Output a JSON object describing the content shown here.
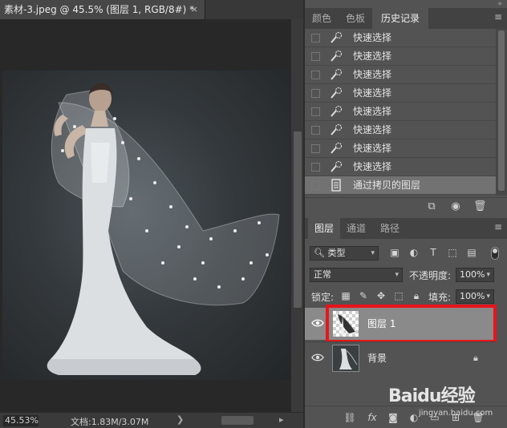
{
  "document": {
    "tab_title": "素材-3.jpeg @ 45.5% (图层 1, RGB/8#) *",
    "tab_close": "×"
  },
  "status": {
    "zoom": "45.53%",
    "doc_info": "文档:1.83M/3.07M",
    "arrow": "❯"
  },
  "history_panel": {
    "tabs": [
      "颜色",
      "色板",
      "历史记录"
    ],
    "active_tab": "历史记录",
    "items": [
      {
        "label": "快速选择"
      },
      {
        "label": "快速选择"
      },
      {
        "label": "快速选择"
      },
      {
        "label": "快速选择"
      },
      {
        "label": "快速选择"
      },
      {
        "label": "快速选择"
      },
      {
        "label": "快速选择"
      },
      {
        "label": "快速选择"
      },
      {
        "label": "通过拷贝的图层",
        "selected": true
      }
    ]
  },
  "layers_panel": {
    "tabs": [
      "图层",
      "通道",
      "路径"
    ],
    "active_tab": "图层",
    "filter_kind": "类型",
    "blend_mode": "正常",
    "opacity_label": "不透明度:",
    "opacity_value": "100%",
    "lock_label": "锁定:",
    "fill_label": "填充:",
    "fill_value": "100%",
    "layers": [
      {
        "name": "图层 1",
        "selected": true,
        "visible": true,
        "locked": false
      },
      {
        "name": "背景",
        "selected": false,
        "visible": true,
        "locked": true
      }
    ]
  },
  "watermark": {
    "brand": "Baidu经验",
    "url": "jingyan.baidu.com"
  },
  "colors": {
    "highlight_border": "#e8141c",
    "panel_bg": "#535353",
    "selected_row": "#8a8a8a"
  }
}
